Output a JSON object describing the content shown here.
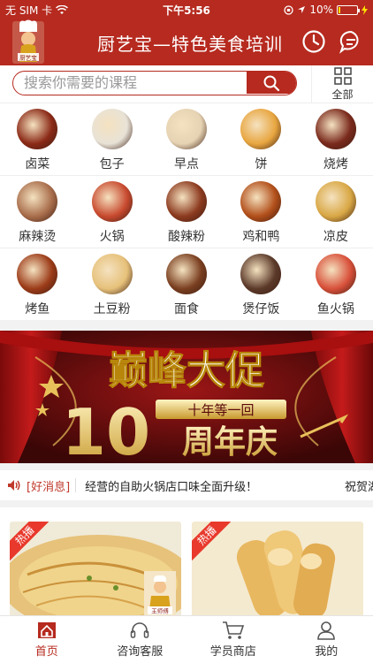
{
  "status": {
    "carrier": "无 SIM 卡",
    "time": "下午5:56",
    "battery": "10%",
    "battery_level": 0.1
  },
  "header": {
    "title": "厨艺宝—特色美食培训",
    "logo_text": "厨艺宝",
    "history_icon": "clock-icon",
    "message_icon": "chat-icon"
  },
  "search": {
    "placeholder": "搜索你需要的课程",
    "all_label": "全部"
  },
  "categories": [
    {
      "label": "卤菜",
      "color": "#8b2a17"
    },
    {
      "label": "包子",
      "color": "#e8e2d6"
    },
    {
      "label": "早点",
      "color": "#e6d3b3"
    },
    {
      "label": "饼",
      "color": "#e8a640"
    },
    {
      "label": "烧烤",
      "color": "#7a2a1c"
    },
    {
      "label": "麻辣烫",
      "color": "#a96e4c"
    },
    {
      "label": "火锅",
      "color": "#c84a2f"
    },
    {
      "label": "酸辣粉",
      "color": "#8c3a1f"
    },
    {
      "label": "鸡和鸭",
      "color": "#b24f1a"
    },
    {
      "label": "凉皮",
      "color": "#d9a845"
    },
    {
      "label": "烤鱼",
      "color": "#9c3b18"
    },
    {
      "label": "土豆粉",
      "color": "#e6c17a"
    },
    {
      "label": "面食",
      "color": "#7a3f20"
    },
    {
      "label": "煲仔饭",
      "color": "#5c3a2a"
    },
    {
      "label": "鱼火锅",
      "color": "#d8503a"
    }
  ],
  "banner": {
    "headline": "巅峰大促",
    "number": "10",
    "ribbon": "十年等一回",
    "sub": "周年庆"
  },
  "notice": {
    "tag": "[好消息]",
    "message": "经营的自助火锅店口味全面升级！",
    "message2": "祝贺湖"
  },
  "cards": [
    {
      "badge": "热播",
      "seal": "王师傅"
    },
    {
      "badge": "热播"
    }
  ],
  "tabs": [
    {
      "label": "首页",
      "active": true
    },
    {
      "label": "咨询客服",
      "active": false
    },
    {
      "label": "学员商店",
      "active": false
    },
    {
      "label": "我的",
      "active": false
    }
  ],
  "colors": {
    "brand": "#b62a1f",
    "gold": "#e8c15a"
  }
}
